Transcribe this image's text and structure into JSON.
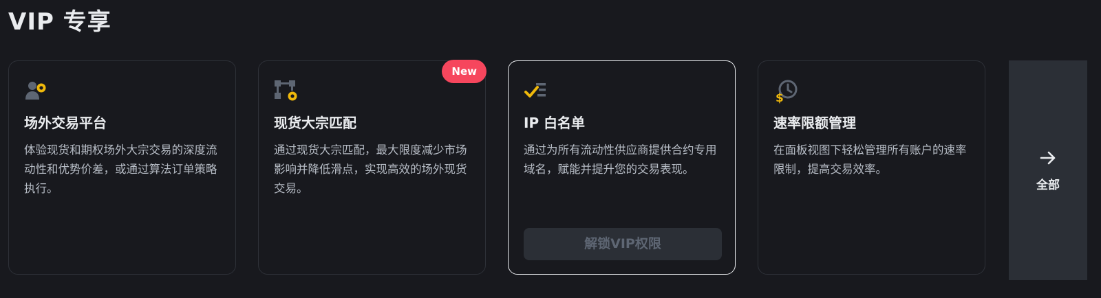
{
  "header": {
    "title": "VIP 专享"
  },
  "cards": [
    {
      "icon": "user-coin-icon",
      "title": "场外交易平台",
      "desc": "体验现货和期权场外大宗交易的深度流动性和优势价差，或通过算法订单策略执行。"
    },
    {
      "icon": "block-match-icon",
      "badge": "New",
      "title": "现货大宗匹配",
      "desc": "通过现货大宗匹配，最大限度减少市场影响并降低滑点，实现高效的场外现货交易。"
    },
    {
      "icon": "checklist-icon",
      "title": "IP 白名单",
      "desc": "通过为所有流动性供应商提供合约专用域名，赋能并提升您的交易表现。",
      "button": "解锁VIP权限"
    },
    {
      "icon": "dollar-clock-icon",
      "title": "速率限额管理",
      "desc": "在面板视图下轻松管理所有账户的速率限制，提高交易效率。"
    }
  ],
  "all_button": {
    "icon": "arrow-right-icon",
    "label": "全部"
  },
  "colors": {
    "background": "#18191e",
    "accent": "#f0b90b",
    "badge": "#f6465d",
    "icon_gray": "#848e9c"
  }
}
